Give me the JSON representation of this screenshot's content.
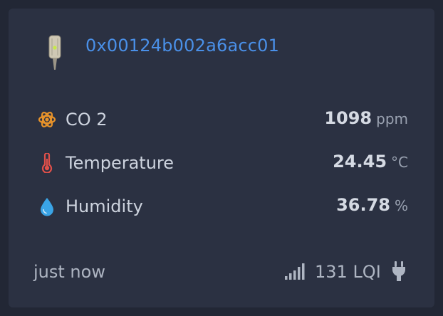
{
  "device": {
    "id": "0x00124b002a6acc01",
    "icon": "sensor-device-icon"
  },
  "readings": [
    {
      "label": "CO 2",
      "value": "1098",
      "unit": "ppm",
      "icon": "co2-molecule-icon",
      "color": "#e8932a"
    },
    {
      "label": "Temperature",
      "value": "24.45",
      "unit": "°C",
      "icon": "thermometer-icon",
      "color": "#e0504a"
    },
    {
      "label": "Humidity",
      "value": "36.78",
      "unit": "%",
      "icon": "water-drop-icon",
      "color": "#3aa4e6"
    }
  ],
  "footer": {
    "last_seen": "just now",
    "lqi": "131 LQI",
    "signal_icon": "signal-strength-icon",
    "power_icon": "plug-icon"
  },
  "colors": {
    "background": "#222735",
    "card": "#2b3142",
    "link": "#4a90e8"
  }
}
